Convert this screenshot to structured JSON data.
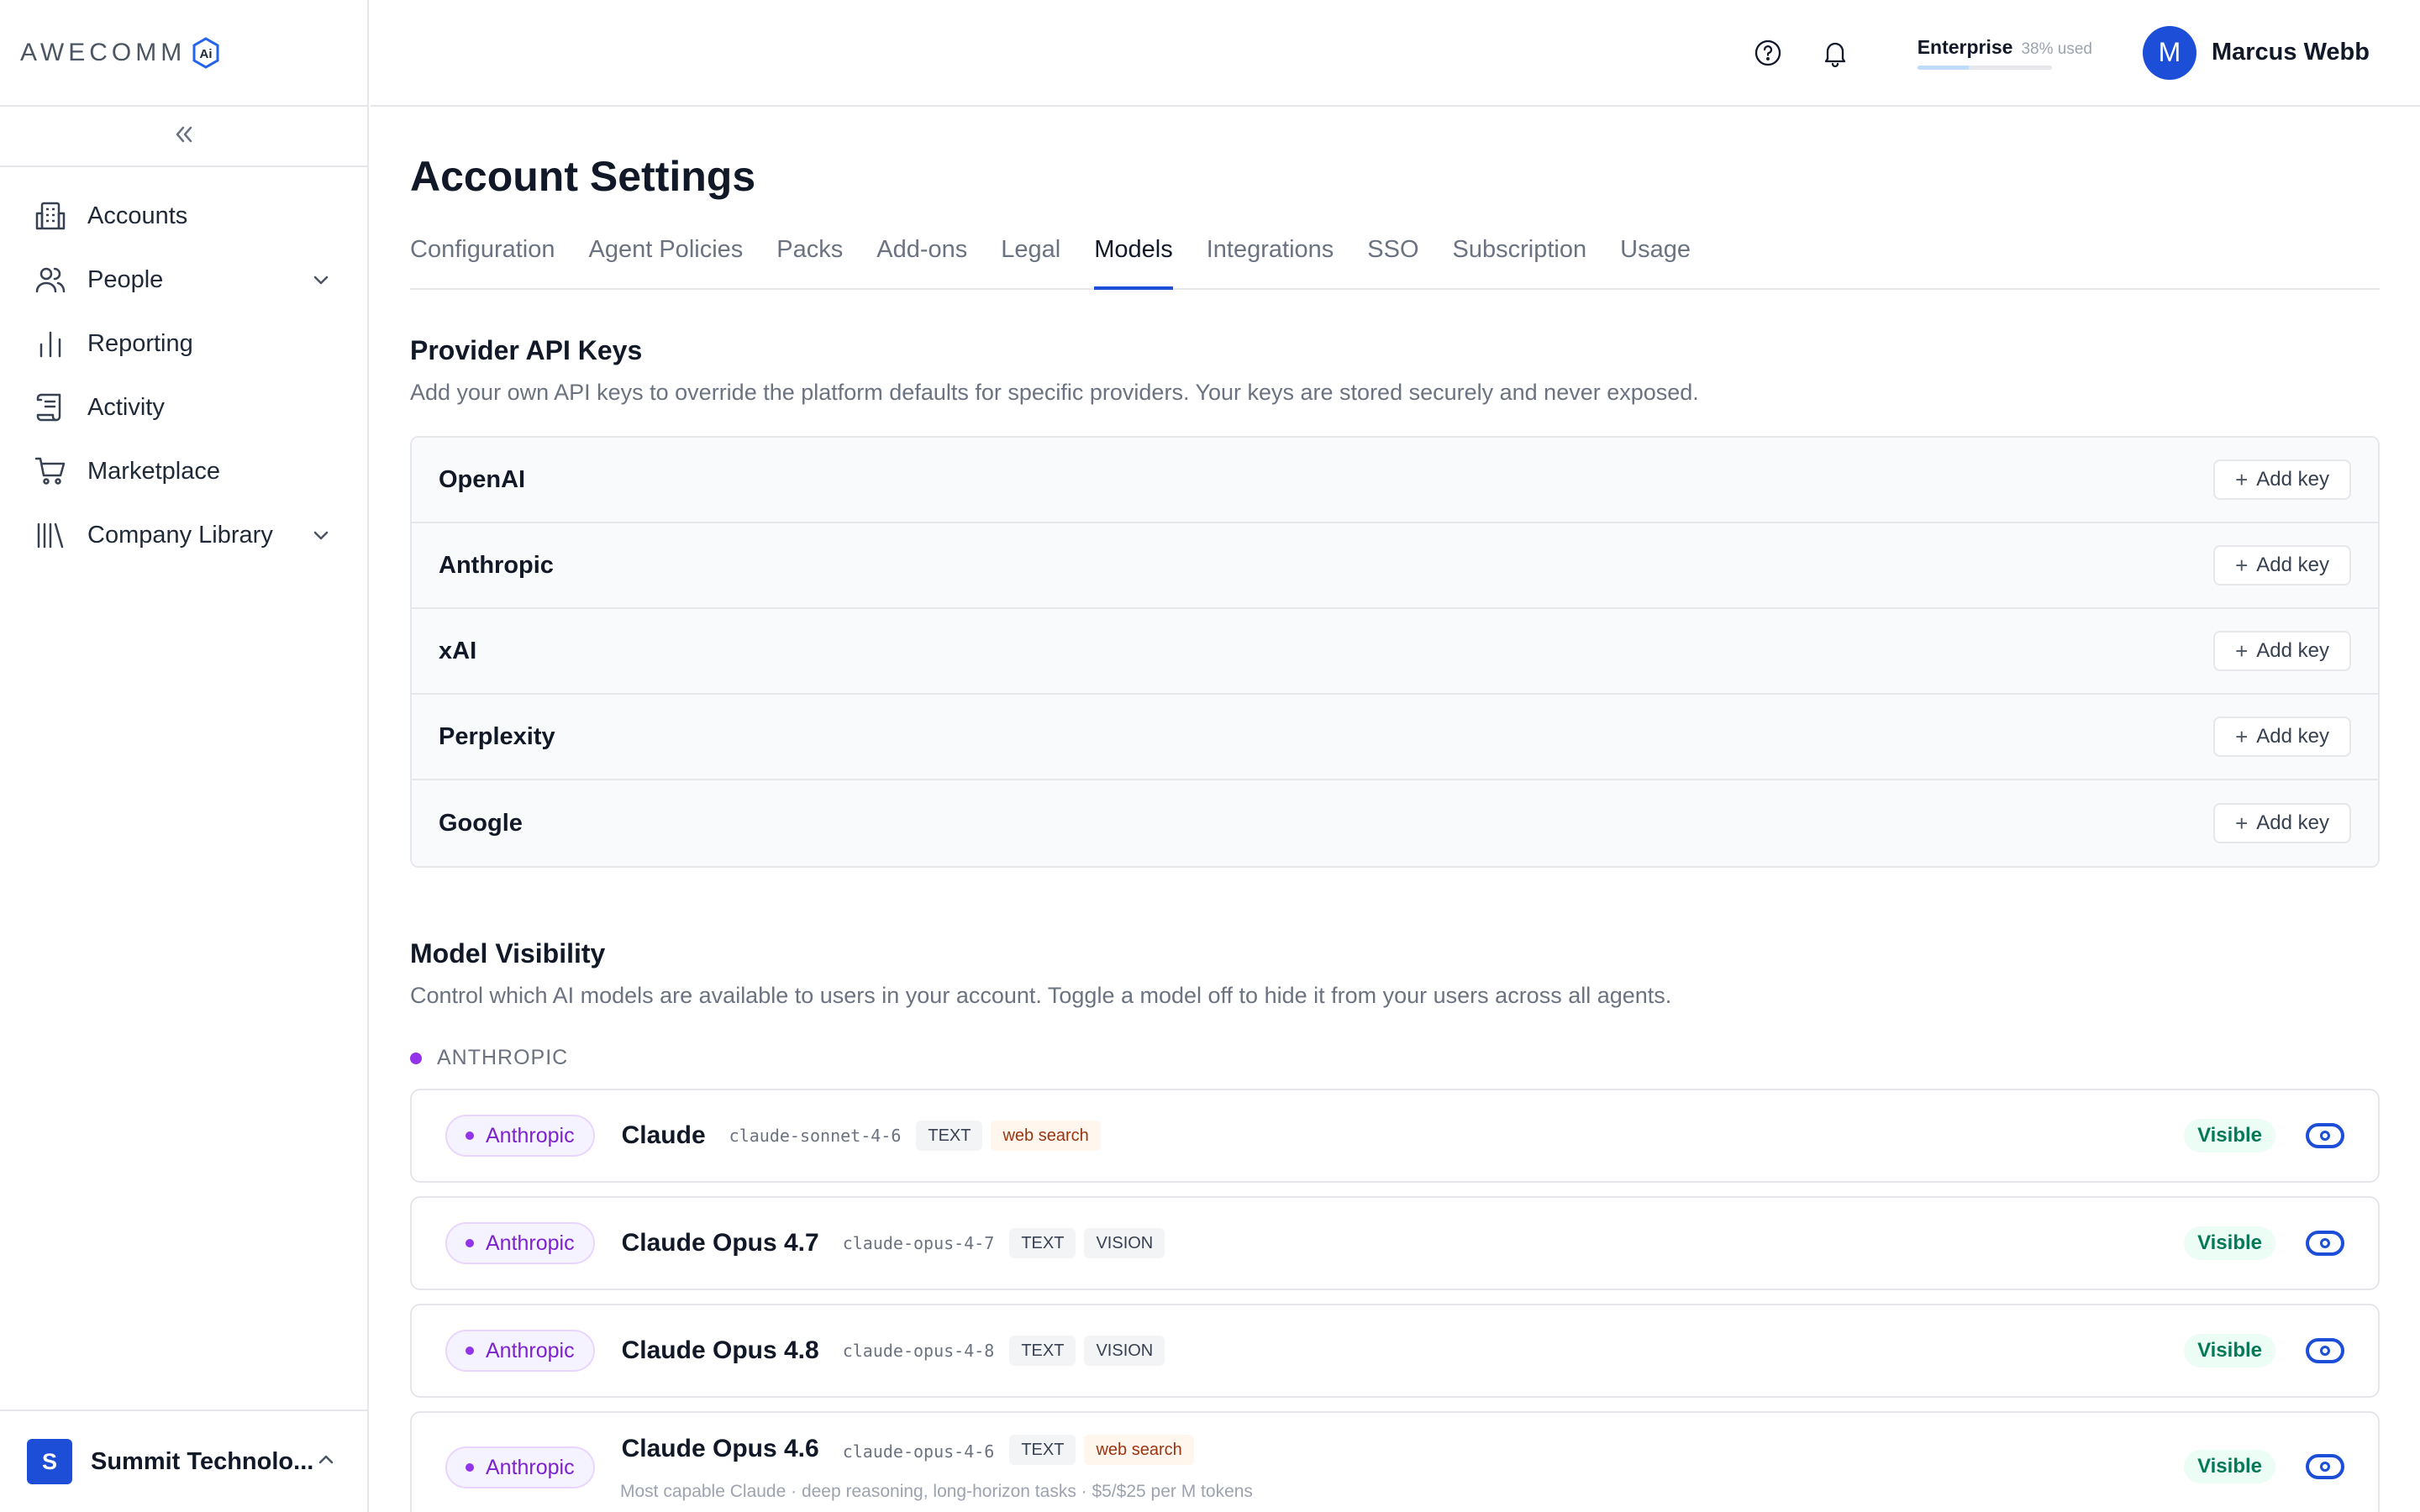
{
  "brand": {
    "logo_text": "AWECOMM",
    "logo_badge": "Ai",
    "accent": "#1d4ed8",
    "purple": "#9333ea"
  },
  "sidebar": {
    "items": [
      {
        "label": "Accounts",
        "icon": "building-icon",
        "has_chevron": false
      },
      {
        "label": "People",
        "icon": "people-icon",
        "has_chevron": true
      },
      {
        "label": "Reporting",
        "icon": "bar-chart-icon",
        "has_chevron": false
      },
      {
        "label": "Activity",
        "icon": "scroll-icon",
        "has_chevron": false
      },
      {
        "label": "Marketplace",
        "icon": "cart-icon",
        "has_chevron": false
      },
      {
        "label": "Company Library",
        "icon": "library-icon",
        "has_chevron": true
      }
    ],
    "org": {
      "initial": "S",
      "name": "Summit Technolo..."
    }
  },
  "header": {
    "plan_name": "Enterprise",
    "plan_used": "38% used",
    "plan_used_fraction": 0.38,
    "user_initial": "M",
    "user_name": "Marcus Webb"
  },
  "page": {
    "title": "Account Settings",
    "tabs": [
      {
        "label": "Configuration"
      },
      {
        "label": "Agent Policies"
      },
      {
        "label": "Packs"
      },
      {
        "label": "Add-ons"
      },
      {
        "label": "Legal"
      },
      {
        "label": "Models",
        "active": true
      },
      {
        "label": "Integrations"
      },
      {
        "label": "SSO"
      },
      {
        "label": "Subscription"
      },
      {
        "label": "Usage"
      }
    ]
  },
  "api_keys": {
    "title": "Provider API Keys",
    "description": "Add your own API keys to override the platform defaults for specific providers. Your keys are stored securely and never exposed.",
    "add_label": "Add key",
    "providers": [
      "OpenAI",
      "Anthropic",
      "xAI",
      "Perplexity",
      "Google"
    ]
  },
  "visibility": {
    "title": "Model Visibility",
    "description": "Control which AI models are available to users in your account. Toggle a model off to hide it from your users across all agents.",
    "group_label": "ANTHROPIC",
    "status_label": "Visible",
    "models": [
      {
        "provider": "Anthropic",
        "name": "Claude",
        "id": "claude-sonnet-4-6",
        "tags": [
          "TEXT",
          "web search"
        ]
      },
      {
        "provider": "Anthropic",
        "name": "Claude Opus 4.7",
        "id": "claude-opus-4-7",
        "tags": [
          "TEXT",
          "VISION"
        ]
      },
      {
        "provider": "Anthropic",
        "name": "Claude Opus 4.8",
        "id": "claude-opus-4-8",
        "tags": [
          "TEXT",
          "VISION"
        ]
      },
      {
        "provider": "Anthropic",
        "name": "Claude Opus 4.6",
        "id": "claude-opus-4-6",
        "tags": [
          "TEXT",
          "web search"
        ],
        "description": "Most capable Claude · deep reasoning, long-horizon tasks · $5/$25 per M tokens"
      }
    ]
  }
}
